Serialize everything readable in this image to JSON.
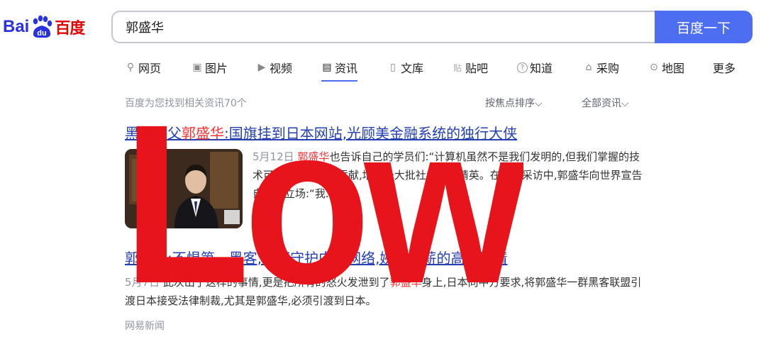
{
  "logo": {
    "text_en": "Bai",
    "text_cn": "百度",
    "paw_text": "du"
  },
  "search": {
    "query": "郭盛华",
    "button_label": "百度一下"
  },
  "tabs": [
    {
      "label": "网页",
      "icon": "search-icon",
      "glyph": "⚲"
    },
    {
      "label": "图片",
      "icon": "image-icon",
      "glyph": "▣"
    },
    {
      "label": "视频",
      "icon": "video-icon",
      "glyph": "▶"
    },
    {
      "label": "资讯",
      "icon": "news-icon",
      "glyph": "▤",
      "active": true
    },
    {
      "label": "文库",
      "icon": "doc-icon",
      "glyph": "▯"
    },
    {
      "label": "贴吧",
      "icon": "tieba-icon",
      "glyph": "贴"
    },
    {
      "label": "知道",
      "icon": "question-icon",
      "glyph": "?"
    },
    {
      "label": "采购",
      "icon": "purchase-icon",
      "glyph": "⌂"
    },
    {
      "label": "地图",
      "icon": "map-icon",
      "glyph": "⊙"
    },
    {
      "label": "更多",
      "icon": "",
      "glyph": ""
    }
  ],
  "toolbar": {
    "result_count": "百度为您找到相关资讯70个",
    "sort_label": "按焦点排序",
    "filter_label": "全部资讯"
  },
  "results": [
    {
      "title_pre": "黑客教父",
      "title_em": "郭盛华",
      "title_post": ":国旗挂到日本网站,光顾美金融系统的独行大侠",
      "date": "5月12日",
      "snippet_em": "郭盛华",
      "snippet": "也告诉自己的学员们:“计算机虽然不是我们发明的,但我们掌握的技术可以为祖国做出贡献,培养一大批社会网络精英。在一次采访中,郭盛华向世界宣告自己的立场:“我...",
      "source": "网易"
    },
    {
      "title_pre": "郭盛华:不惧第一黑客,誓死守护中国网络,婉拒高薪的高薪聘请",
      "title_em": "",
      "title_post": "",
      "date": "5月7日",
      "snippet_pre": "此次出了这样的事情,更是把所有的怒火发泄到了",
      "snippet_em": "郭盛华",
      "snippet": "身上,日本向中方要求,将郭盛华一群黑客联盟引渡日本接受法律制裁,尤其是郭盛华,必须引渡到日本。",
      "source": "网易新闻"
    }
  ],
  "watermark": {
    "text": "Low",
    "color": "#e8141c"
  },
  "colors": {
    "accent": "#4e6ef2",
    "link": "#2440b3",
    "highlight": "#f73131"
  }
}
